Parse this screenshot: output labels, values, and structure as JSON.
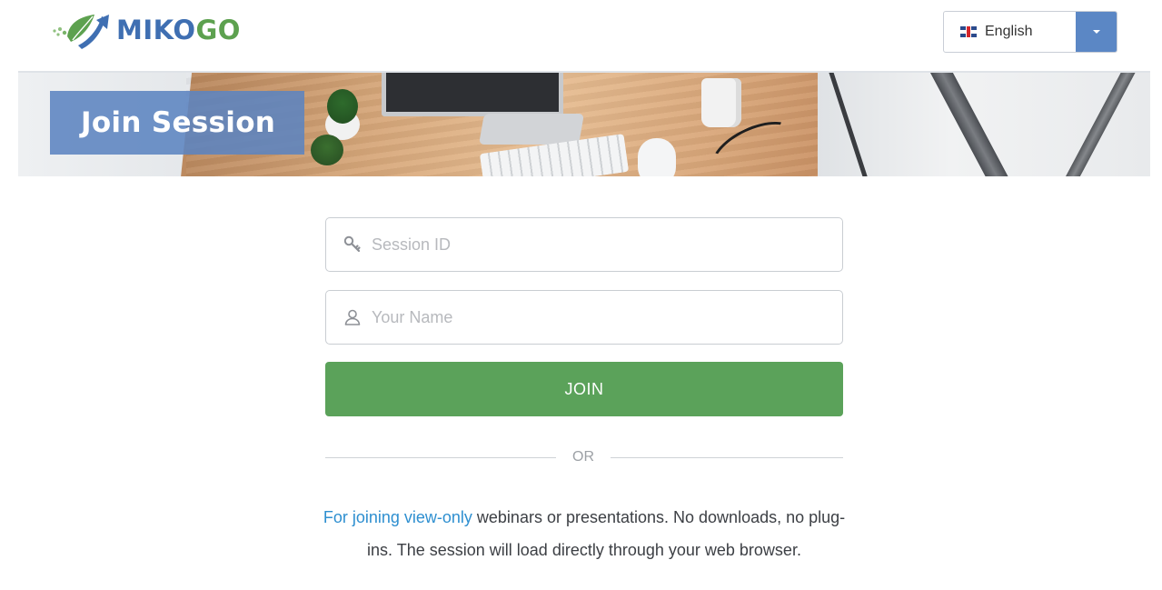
{
  "brand": {
    "name_part1": "MIKO",
    "name_part2": "GO",
    "accent": "#3f6fb2",
    "green": "#5da14f"
  },
  "language": {
    "selected": "English",
    "flag_icon": "uk-flag-icon",
    "caret_icon": "chevron-down-icon"
  },
  "banner": {
    "title": "Join Session"
  },
  "form": {
    "session_id_placeholder": "Session ID",
    "session_id_icon": "key-icon",
    "name_placeholder": "Your Name",
    "name_icon": "user-icon",
    "join_label": "JOIN",
    "join_color": "#5ba25a"
  },
  "divider": {
    "text": "OR"
  },
  "note": {
    "link_text": "For joining view-only",
    "text": " webinars or presentations. No downloads, no plug-ins. The session will load directly through your web browser."
  }
}
